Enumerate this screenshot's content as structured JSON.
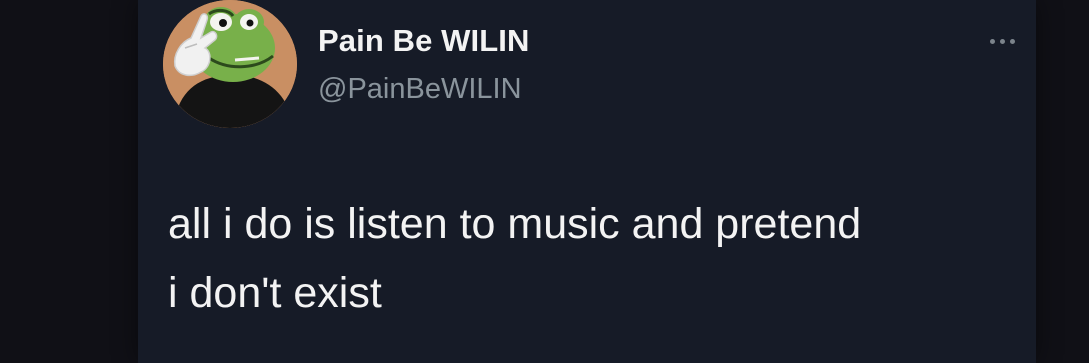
{
  "tweet": {
    "author": {
      "display_name": "Pain Be WILIN",
      "handle": "@PainBeWILIN",
      "avatar_icon": "frog-avatar-icon"
    },
    "text_lines": [
      "all i do is listen to music and pretend",
      "i don't exist"
    ],
    "menu_icon": "more-options-icon"
  },
  "colors": {
    "page_background": "#101016",
    "card_background": "#161b27",
    "primary_text": "#f3f3f3",
    "secondary_text": "#8a949c",
    "avatar_background": "#c98f63"
  }
}
